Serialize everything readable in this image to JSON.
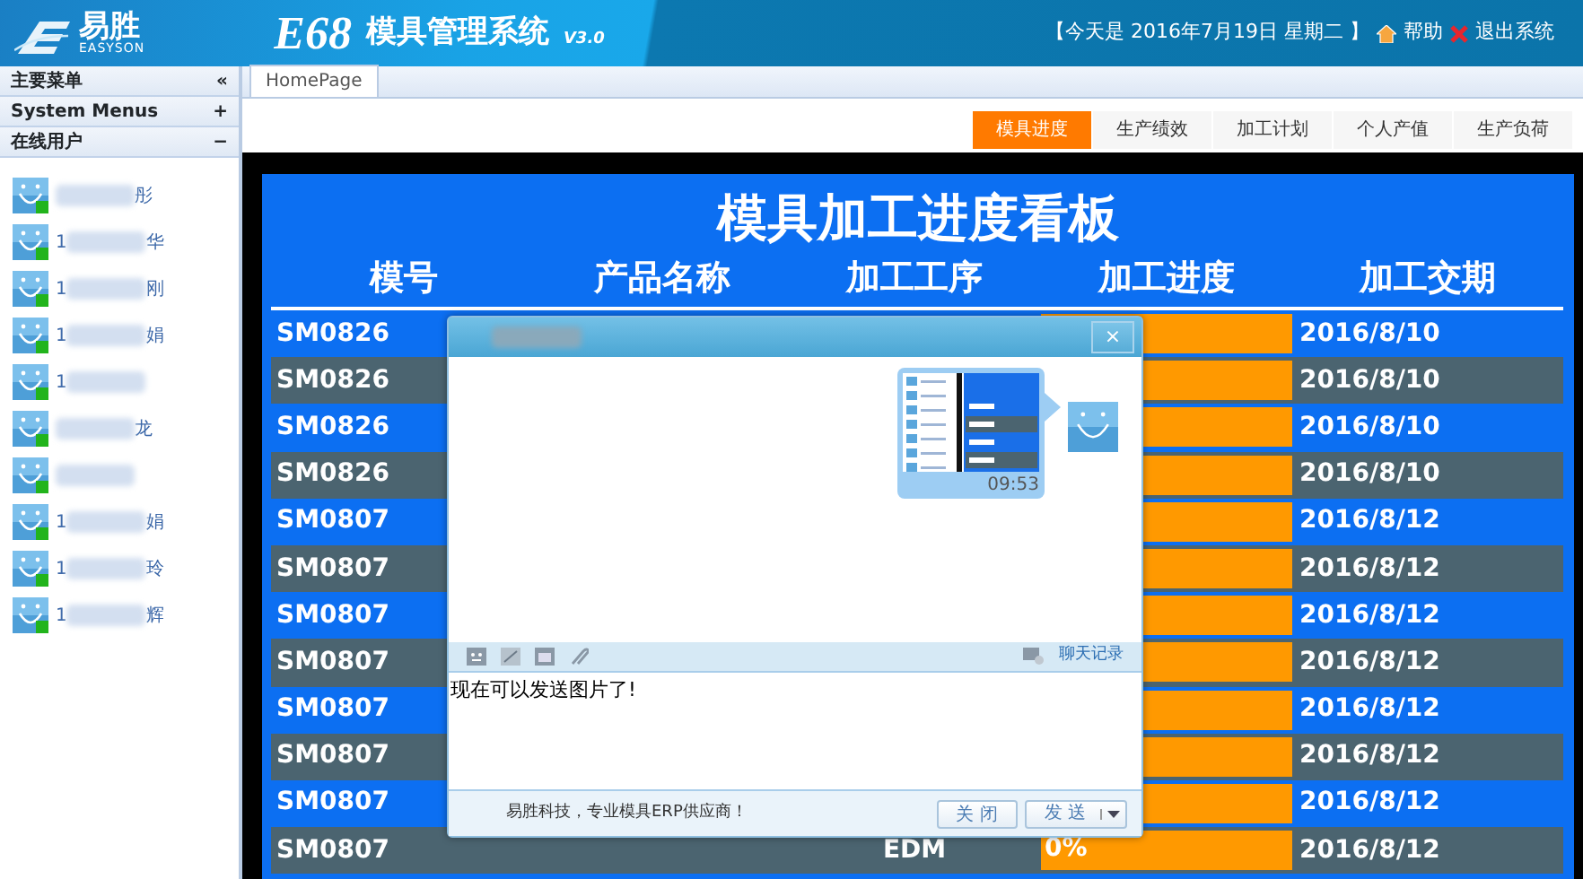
{
  "header": {
    "logo_text": "易胜",
    "logo_subtext": "EASYSON",
    "product": "E68",
    "system_name": "模具管理系统",
    "version": "V3.0",
    "date_text": "【今天是 2016年7月19日 星期二 】",
    "help": "帮助",
    "logout": "退出系统"
  },
  "sidebar": {
    "sections": [
      {
        "title": "主要菜单",
        "toggle": "«"
      },
      {
        "title": "System Menus",
        "toggle": "+"
      },
      {
        "title": "在线用户",
        "toggle": "−"
      }
    ],
    "online_users": [
      {
        "blurred": true,
        "name_end": "彤"
      },
      {
        "name": "1",
        "blurred": true,
        "name_end": "华"
      },
      {
        "name": "1",
        "blurred": true,
        "name_end": "刚"
      },
      {
        "name": "1",
        "blurred": true,
        "name_end": "娟"
      },
      {
        "name": "1",
        "blurred": true
      },
      {
        "blurred": true,
        "name_end": "龙"
      },
      {
        "blurred": true
      },
      {
        "name": "1",
        "blurred": true,
        "name_end": "娟"
      },
      {
        "name": "1",
        "blurred": true,
        "name_end": "玲"
      },
      {
        "name": "1",
        "blurred": true,
        "name_end": "辉"
      }
    ]
  },
  "page_tabs": [
    {
      "label": "HomePage",
      "selected": true
    }
  ],
  "board_tabs": [
    {
      "label": "模具进度",
      "selected": true
    },
    {
      "label": "生产绩效",
      "selected": false
    },
    {
      "label": "加工计划",
      "selected": false
    },
    {
      "label": "个人产值",
      "selected": false
    },
    {
      "label": "生产负荷",
      "selected": false
    }
  ],
  "board": {
    "title": "模具加工进度看板",
    "columns": [
      "模号",
      "产品名称",
      "加工工序",
      "加工进度",
      "加工交期"
    ],
    "rows": [
      {
        "mold": "SM0826",
        "date": "2016/8/10"
      },
      {
        "mold": "SM0826",
        "date": "2016/8/10"
      },
      {
        "mold": "SM0826",
        "date": "2016/8/10"
      },
      {
        "mold": "SM0826",
        "date": "2016/8/10"
      },
      {
        "mold": "SM0807",
        "date": "2016/8/12"
      },
      {
        "mold": "SM0807",
        "date": "2016/8/12"
      },
      {
        "mold": "SM0807",
        "date": "2016/8/12"
      },
      {
        "mold": "SM0807",
        "date": "2016/8/12"
      },
      {
        "mold": "SM0807",
        "date": "2016/8/12"
      },
      {
        "mold": "SM0807",
        "date": "2016/8/12"
      },
      {
        "mold": "SM0807",
        "date": "2016/8/12"
      },
      {
        "mold": "SM0807",
        "process": "EDM",
        "progress": "0%",
        "date": "2016/8/12"
      }
    ]
  },
  "chat_dialog": {
    "close": "×",
    "messages": [
      {
        "kind": "image",
        "time": "09:53"
      }
    ],
    "history_link": "聊天记录",
    "input_value": "现在可以发送图片了!",
    "footer_text": "易胜科技，专业模具ERP供应商！",
    "buttons": [
      "关 闭",
      "发 送"
    ]
  }
}
